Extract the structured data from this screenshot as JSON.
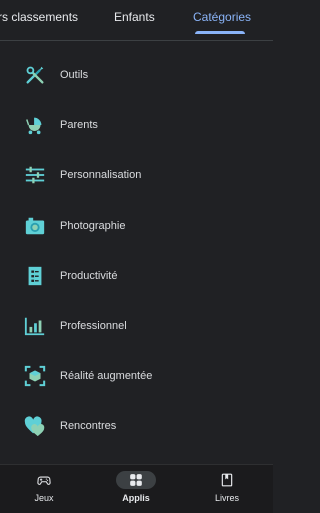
{
  "tabs": [
    {
      "label": "rs classements"
    },
    {
      "label": "Enfants"
    },
    {
      "label": "Catégories"
    }
  ],
  "categories": [
    {
      "label": "Outils",
      "icon": "tools-icon"
    },
    {
      "label": "Parents",
      "icon": "stroller-icon"
    },
    {
      "label": "Personnalisation",
      "icon": "sliders-icon"
    },
    {
      "label": "Photographie",
      "icon": "camera-icon"
    },
    {
      "label": "Productivité",
      "icon": "checklist-icon"
    },
    {
      "label": "Professionnel",
      "icon": "bar-chart-icon"
    },
    {
      "label": "Réalité augmentée",
      "icon": "ar-frame-icon"
    },
    {
      "label": "Rencontres",
      "icon": "hearts-icon"
    }
  ],
  "bottom_nav": [
    {
      "label": "Jeux",
      "icon": "gamepad-icon"
    },
    {
      "label": "Applis",
      "icon": "apps-grid-icon"
    },
    {
      "label": "Livres",
      "icon": "book-icon"
    }
  ],
  "colors": {
    "accent": "#8ab4f8",
    "icon_teal": "#5fd0d6",
    "icon_green": "#8ed1b4",
    "background": "#202124"
  }
}
